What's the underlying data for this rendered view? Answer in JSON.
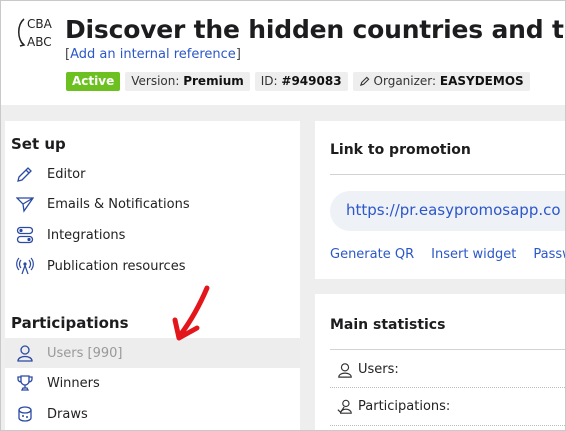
{
  "header": {
    "logo_text_top": "CBA",
    "logo_text_bottom": "ABC",
    "title": "Discover the hidden countries and travel",
    "reference_open": "[",
    "reference_link": "Add an internal reference",
    "reference_close": "]",
    "badges": {
      "status": "Active",
      "version_label": "Version:",
      "version_value": "Premium",
      "id_label": "ID:",
      "id_value": "#949083",
      "organizer_label": "Organizer:",
      "organizer_value": "EASYDEMOS"
    }
  },
  "sidebar": {
    "setup_title": "Set up",
    "setup_items": [
      {
        "label": "Editor",
        "icon": "pencil-icon"
      },
      {
        "label": "Emails & Notifications",
        "icon": "paper-plane-icon"
      },
      {
        "label": "Integrations",
        "icon": "toggle-icon"
      },
      {
        "label": "Publication resources",
        "icon": "broadcast-icon"
      }
    ],
    "participations_title": "Participations",
    "participation_items": [
      {
        "label": "Users [990]",
        "icon": "user-icon",
        "selected": true
      },
      {
        "label": "Winners",
        "icon": "trophy-icon"
      },
      {
        "label": "Draws",
        "icon": "draw-icon"
      }
    ]
  },
  "promotion_link": {
    "title": "Link to promotion",
    "url": "https://pr.easypromosapp.co",
    "actions": [
      "Generate QR",
      "Insert widget",
      "Passw"
    ]
  },
  "statistics": {
    "title": "Main statistics",
    "rows": [
      {
        "label": "Users:",
        "icon": "user-icon"
      },
      {
        "label": "Participations:",
        "icon": "participations-icon"
      }
    ]
  },
  "annotation": {
    "color": "#e3161b",
    "icon": "red-arrow-icon"
  }
}
